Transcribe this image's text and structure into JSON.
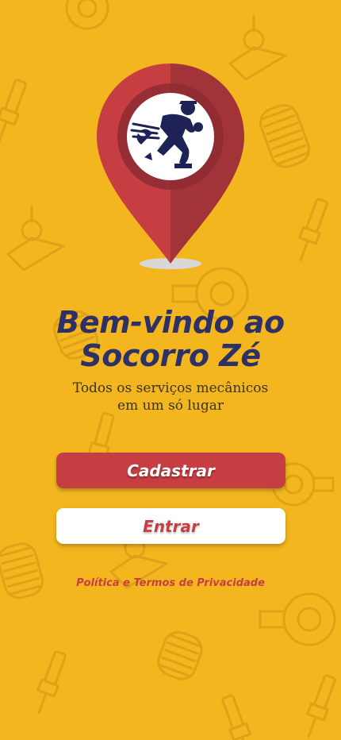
{
  "welcome": {
    "title_line1": "Bem-vindo ao",
    "title_line2": "Socorro Zé",
    "subtitle_line1": "Todos os serviços mecânicos",
    "subtitle_line2": "em um só lugar"
  },
  "actions": {
    "signup_label": "Cadastrar",
    "login_label": "Entrar"
  },
  "footer": {
    "policy_label": "Política e Termos de Privacidade"
  },
  "theme": {
    "background": "#F3B61F",
    "accent_red": "#C73E42",
    "navy": "#2E3166"
  },
  "icons": {
    "logo": "location-pin-mechanic-icon",
    "pattern": [
      "spark-plug-icon",
      "coil-spring-icon",
      "turbocharger-icon",
      "suspension-joint-icon"
    ]
  }
}
